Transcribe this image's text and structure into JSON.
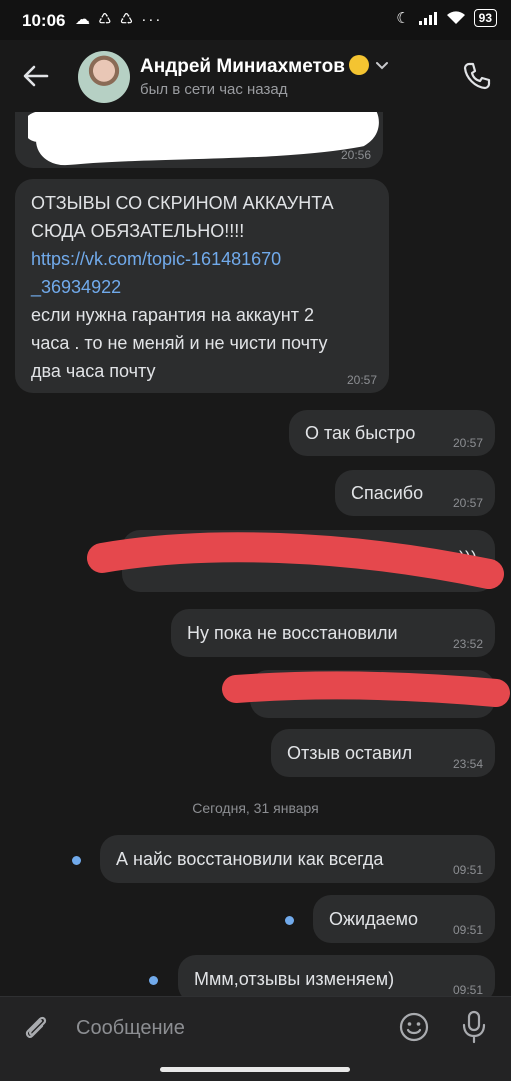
{
  "status_bar": {
    "time": "10:06",
    "battery": "93",
    "left_icons": [
      "messenger-icon",
      "recycle-icon",
      "recycle-icon",
      "more-icon"
    ],
    "right_icons": [
      "do-not-disturb-icon",
      "signal-icon",
      "wifi-icon",
      "battery-icon"
    ]
  },
  "header": {
    "contact_name": "Андрей Миниахметов",
    "status": "был в сети час назад"
  },
  "messages": [
    {
      "id": "m1",
      "direction": "in",
      "text": "",
      "time": "20:56"
    },
    {
      "id": "m2",
      "direction": "in",
      "line1": "ОТЗЫВЫ СО СКРИНОМ АККАУНТА",
      "line2": "СЮДА ОБЯЗАТЕЛЬНО!!!!",
      "link1": "https://vk.com/topic-161481670",
      "link2": "_36934922",
      "line3": "если нужна гарантия на аккаунт 2",
      "line4": "часа . то не меняй и не чисти почту",
      "line5": "два часа почту",
      "time": "20:57"
    },
    {
      "id": "m3",
      "direction": "out",
      "text": "О так быстро",
      "time": "20:57"
    },
    {
      "id": "m4",
      "direction": "out",
      "text": "Спасибо",
      "time": "20:57"
    },
    {
      "id": "m5",
      "direction": "out",
      "text": "если не реснут)))",
      "time": ""
    },
    {
      "id": "m6",
      "direction": "out",
      "text": "Ну пока не восстановили",
      "time": "23:52"
    },
    {
      "id": "m7",
      "direction": "out",
      "text": "",
      "time": ""
    },
    {
      "id": "m8",
      "direction": "out",
      "text": "Отзыв оставил",
      "time": "23:54"
    },
    {
      "id": "m9",
      "direction": "out",
      "text": "А найс восстановили как всегда",
      "time": "09:51",
      "unread": true
    },
    {
      "id": "m10",
      "direction": "out",
      "text": "Ожидаемо",
      "time": "09:51",
      "unread": true
    },
    {
      "id": "m11",
      "direction": "out",
      "text": "Ммм,отзывы изменяем)",
      "time": "09:51",
      "unread": true
    }
  ],
  "date_separator": "Сегодня, 31 января",
  "composer": {
    "placeholder": "Сообщение"
  },
  "colors": {
    "background": "#191919",
    "bubble": "#2c2d2e",
    "link": "#71aaeb",
    "redaction_white": "#ffffff",
    "redaction_red": "#e5484d",
    "unread_dot": "#71aaeb"
  }
}
